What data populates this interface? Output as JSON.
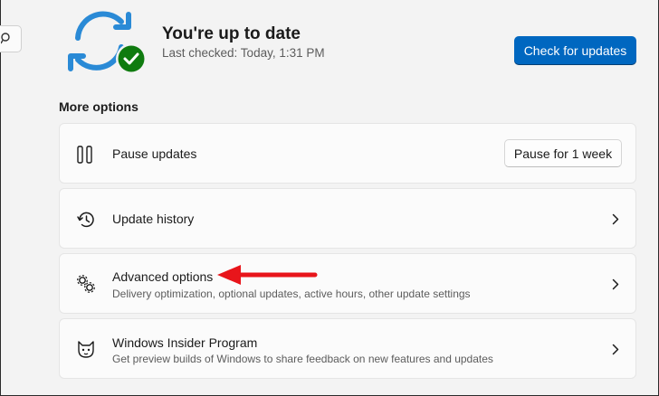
{
  "status": {
    "title": "You're up to date",
    "last_checked": "Last checked: Today, 1:31 PM",
    "check_button": "Check for updates"
  },
  "more_options": {
    "title": "More options",
    "items": [
      {
        "label": "Pause updates",
        "icon": "pause-icon",
        "action_button": "Pause for 1 week"
      },
      {
        "label": "Update history",
        "icon": "history-icon"
      },
      {
        "label": "Advanced options",
        "icon": "gears-icon",
        "description": "Delivery optimization, optional updates, active hours, other update settings"
      },
      {
        "label": "Windows Insider Program",
        "icon": "insider-cat-icon",
        "description": "Get preview builds of Windows to share feedback on new features and updates"
      }
    ]
  },
  "colors": {
    "accent": "#0067c0",
    "sync_blue": "#2a8ad6",
    "check_green": "#0f7b0f",
    "annotation_arrow": "#e8151b",
    "background": "#f3f3f3",
    "card": "#fbfbfb"
  }
}
